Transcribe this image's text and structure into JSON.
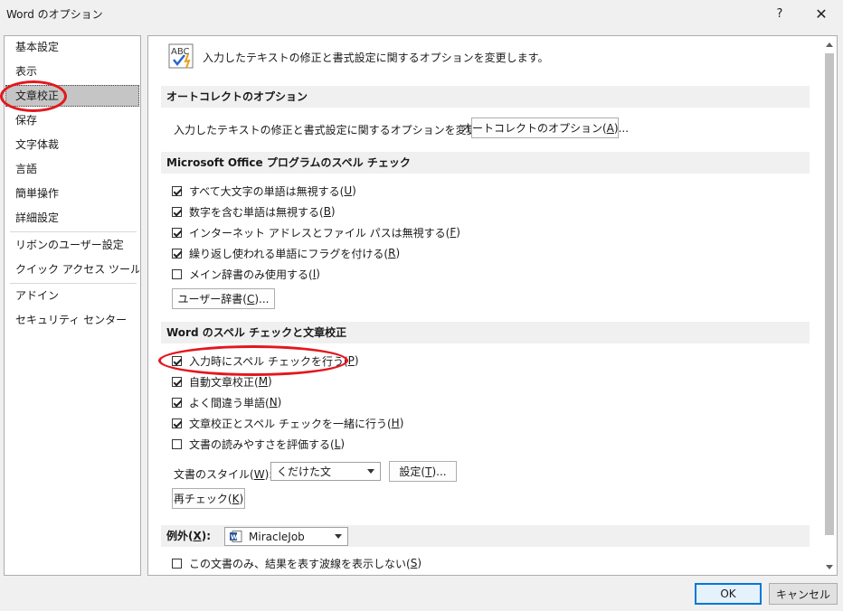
{
  "window": {
    "title": "Word のオプション",
    "help": "?",
    "close": "✕"
  },
  "sidebar": {
    "items": [
      "基本設定",
      "表示",
      "文章校正",
      "保存",
      "文字体裁",
      "言語",
      "簡単操作",
      "詳細設定",
      "リボンのユーザー設定",
      "クイック アクセス ツール バー",
      "アドイン",
      "セキュリティ センター"
    ],
    "selected": "文章校正"
  },
  "main": {
    "intro": "入力したテキストの修正と書式設定に関するオプションを変更します。",
    "autocorrect": {
      "heading": "オートコレクトのオプション",
      "description": "入力したテキストの修正と書式設定に関するオプションを変更します。",
      "button_pre": "オートコレクトのオプション(",
      "button_key": "A",
      "button_post": ")..."
    },
    "office_spell": {
      "heading": "Microsoft Office プログラムのスペル チェック",
      "options": [
        {
          "pre": "すべて大文字の単語は無視する(",
          "key": "U",
          "post": ")",
          "checked": true
        },
        {
          "pre": "数字を含む単語は無視する(",
          "key": "B",
          "post": ")",
          "checked": true
        },
        {
          "pre": "インターネット アドレスとファイル パスは無視する(",
          "key": "F",
          "post": ")",
          "checked": true
        },
        {
          "pre": "繰り返し使われる単語にフラグを付ける(",
          "key": "R",
          "post": ")",
          "checked": true
        },
        {
          "pre": "メイン辞書のみ使用する(",
          "key": "I",
          "post": ")",
          "checked": false
        }
      ],
      "dict_button_pre": "ユーザー辞書(",
      "dict_button_key": "C",
      "dict_button_post": ")..."
    },
    "word_spell": {
      "heading": "Word のスペル チェックと文章校正",
      "options": [
        {
          "pre": "入力時にスペル チェックを行う(",
          "key": "P",
          "post": ")",
          "checked": true
        },
        {
          "pre": "自動文章校正(",
          "key": "M",
          "post": ")",
          "checked": true
        },
        {
          "pre": "よく間違う単語(",
          "key": "N",
          "post": ")",
          "checked": true
        },
        {
          "pre": "文章校正とスペル チェックを一緒に行う(",
          "key": "H",
          "post": ")",
          "checked": true
        },
        {
          "pre": "文書の読みやすさを評価する(",
          "key": "L",
          "post": ")",
          "checked": false
        }
      ],
      "style_label_pre": "文書のスタイル(",
      "style_label_key": "W",
      "style_label_post": "):",
      "style_value": "くだけた文",
      "settings_pre": "設定(",
      "settings_key": "T",
      "settings_post": ")...",
      "recheck_pre": "再チェック(",
      "recheck_key": "K",
      "recheck_post": ")"
    },
    "exceptions": {
      "label_pre": "例外(",
      "label_key": "X",
      "label_post": "):",
      "document": "MiracleJob",
      "option_pre": "この文書のみ、結果を表す波線を表示しない(",
      "option_key": "S",
      "option_post": ")",
      "option_checked": false
    }
  },
  "footer": {
    "ok": "OK",
    "cancel": "キャンセル"
  },
  "colors": {
    "annotation": "#e3171e",
    "accent": "#0078d7"
  }
}
